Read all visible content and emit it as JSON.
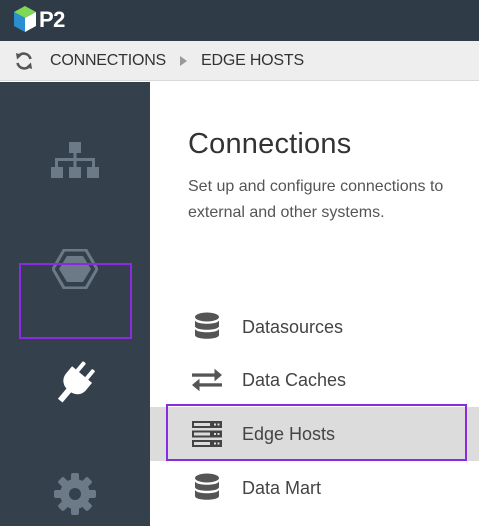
{
  "header": {
    "logo_text": "P2"
  },
  "breadcrumb": {
    "items": [
      "CONNECTIONS",
      "EDGE HOSTS"
    ]
  },
  "sidebar": {
    "items": [
      {
        "icon": "hierarchy-icon",
        "active": false
      },
      {
        "icon": "hexagon-icon",
        "active": false
      },
      {
        "icon": "plug-icon",
        "active": true
      },
      {
        "icon": "gear-icon",
        "active": false
      }
    ]
  },
  "main": {
    "title": "Connections",
    "description": "Set up and configure connections to external and other systems.",
    "items": [
      {
        "label": "Datasources",
        "icon": "database-icon",
        "selected": false
      },
      {
        "label": "Data Caches",
        "icon": "swap-arrows-icon",
        "selected": false
      },
      {
        "label": "Edge Hosts",
        "icon": "server-icon",
        "selected": true
      },
      {
        "label": "Data Mart",
        "icon": "database-icon",
        "selected": false
      }
    ]
  },
  "colors": {
    "topbar": "#2f3c47",
    "sidebar": "#34414d",
    "highlight": "#8a2be2",
    "selected_row": "#dcdcdc"
  }
}
